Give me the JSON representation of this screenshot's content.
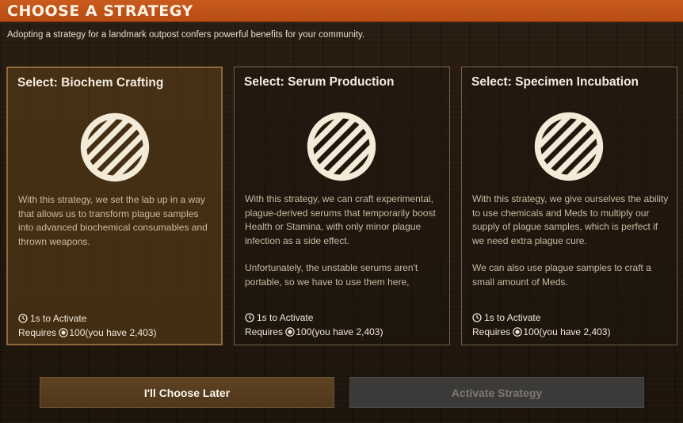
{
  "header": {
    "title": "CHOOSE A STRATEGY"
  },
  "subtitle": "Adopting a strategy for a landmark outpost confers powerful benefits for your community.",
  "cards": [
    {
      "title": "Select: Biochem Crafting",
      "icon": "striped-circle-icon",
      "paragraphs": [
        "With this strategy, we set the lab up in a way that allows us to transform plague samples into advanced biochemical consumables and thrown weapons."
      ],
      "activate_time": "1s to Activate",
      "requires_prefix": "Requires ",
      "requires_amount": "100",
      "requires_suffix": " (you have 2,403)"
    },
    {
      "title": "Select: Serum Production",
      "icon": "striped-circle-icon",
      "paragraphs": [
        "With this strategy, we can craft experimental, plague-derived serums that temporarily boost Health or Stamina, with only minor plague infection as a side effect.",
        "Unfortunately, the unstable serums aren't portable, so we have to use them here,"
      ],
      "activate_time": "1s to Activate",
      "requires_prefix": "Requires ",
      "requires_amount": "100",
      "requires_suffix": " (you have 2,403)"
    },
    {
      "title": "Select: Specimen Incubation",
      "icon": "striped-circle-icon",
      "paragraphs": [
        "With this strategy, we give ourselves the ability to use chemicals and Meds to multiply our supply of plague samples, which is perfect if we need extra plague cure.",
        "We can also use plague samples to craft a small amount of Meds."
      ],
      "activate_time": "1s to Activate",
      "requires_prefix": "Requires ",
      "requires_amount": "100",
      "requires_suffix": " (you have 2,403)"
    }
  ],
  "buttons": {
    "later": "I'll Choose Later",
    "activate": "Activate Strategy"
  },
  "colors": {
    "header_orange": "#c0551a",
    "selected_card": "#5f4119",
    "disabled_button": "#3b3a38"
  }
}
